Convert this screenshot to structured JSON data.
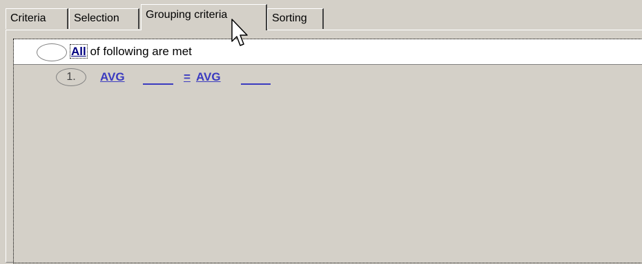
{
  "tabs": [
    {
      "label": "Criteria",
      "active": false
    },
    {
      "label": "Selection",
      "active": false
    },
    {
      "label": "Grouping criteria",
      "active": true
    },
    {
      "label": "Sorting",
      "active": false
    }
  ],
  "tree": {
    "root": {
      "quantifier": "All",
      "text": "of following are met"
    },
    "conditions": [
      {
        "number": "1.",
        "left_function": "AVG",
        "operator": "=",
        "right_function": "AVG"
      }
    ]
  },
  "colors": {
    "background": "#d4d0c8",
    "link": "#3a3ac0",
    "quantifier_link": "#000080"
  },
  "icons": {
    "cursor": "arrow-pointer-icon"
  }
}
